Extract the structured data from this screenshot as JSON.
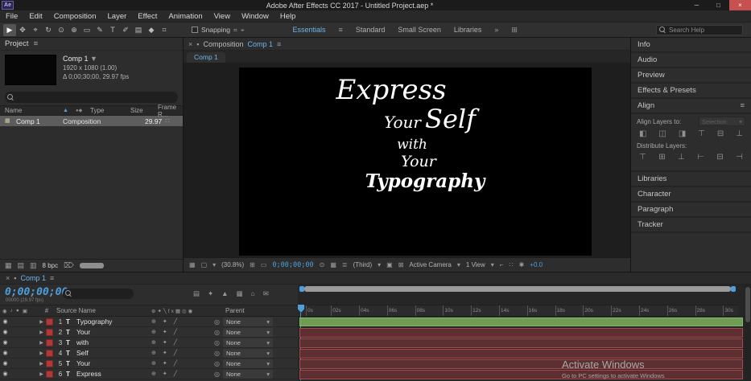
{
  "titlebar": {
    "app_icon": "Ae",
    "title": "Adobe After Effects CC 2017 - Untitled Project.aep *",
    "minimize": "─",
    "maximize": "□",
    "close": "×"
  },
  "menu": {
    "items": [
      "File",
      "Edit",
      "Composition",
      "Layer",
      "Effect",
      "Animation",
      "View",
      "Window",
      "Help"
    ]
  },
  "toolbar": {
    "tools": [
      "▶",
      "✥",
      "⌖",
      "↻",
      "⊙",
      "⊕",
      "▭",
      "✎",
      "T",
      "✐",
      "▤",
      "◆",
      "⌗"
    ],
    "snapping_label": "Snapping",
    "snap_icons": [
      "⌗",
      "⌖"
    ],
    "workspaces": [
      "Essentials",
      "Standard",
      "Small Screen",
      "Libraries"
    ],
    "workspace_menu_icon": "≡",
    "overflow_icon": "»",
    "panel_grid_icon": "⊞",
    "search_placeholder": "Search Help"
  },
  "project": {
    "tab_label": "Project",
    "menu_icon": "≡",
    "comp_name": "Comp 1",
    "comp_caret": "▼",
    "info_line1": "1920 x 1080 (1.00)",
    "info_line2": "Δ 0;00;30;00, 29.97 fps",
    "columns": {
      "name": "Name",
      "sort_icon": "▲",
      "tag_icons": "●◆",
      "type": "Type",
      "size": "Size",
      "frame": "Frame R..."
    },
    "row": {
      "icon": "▦",
      "name": "Comp 1",
      "type": "Composition",
      "size": "",
      "frame": "29.97",
      "net_icon": "∷"
    },
    "footer": {
      "icons": [
        "▦",
        "▤",
        "▥"
      ],
      "bpc": "8 bpc",
      "trash_icon": "⌦"
    }
  },
  "viewer": {
    "tab_close": "×",
    "lock_icon": "▪",
    "tab_label": "Composition",
    "tab_comp": "Comp 1",
    "menu_icon": "≡",
    "subtab": "Comp 1",
    "canvas": {
      "l1": "Express",
      "l2a": "Your",
      "l2b": "Self",
      "l3": "with",
      "l4": "Your",
      "l5": "Typography"
    },
    "footer": {
      "icon_grid": "▦",
      "icon_monitor": "▢",
      "zoom_caret": "▾",
      "zoom": "(30.8%)",
      "icon_ruler": "⊞",
      "icon_region": "▭",
      "timecode": "0;00;00;00",
      "icon_snapshot": "⊙",
      "icon_show": "▦",
      "icon_channels": "≣",
      "resolution": "(Third)",
      "caret": "▾",
      "icon_roi": "▣",
      "icon_transp": "⊠",
      "camera": "Active Camera",
      "view": "1 View",
      "icon_pixel": "⌐",
      "icon_views": "∷",
      "icon_settings": "✱",
      "exposure": "+0.0"
    }
  },
  "right": {
    "top_panels": [
      "Info",
      "Audio",
      "Preview",
      "Effects & Presets"
    ],
    "align": {
      "title": "Align",
      "menu_icon": "≡",
      "align_to_label": "Align Layers to:",
      "align_to_value": "Selection",
      "caret": "▾",
      "align_icons": [
        "◧",
        "◫",
        "◨",
        "⊤",
        "⊟",
        "⊥"
      ],
      "distribute_label": "Distribute Layers:",
      "distribute_icons": [
        "⊤",
        "⊞",
        "⊥",
        "⊢",
        "⊟",
        "⊣"
      ]
    },
    "bottom_panels": [
      "Libraries",
      "Character",
      "Paragraph",
      "Tracker"
    ]
  },
  "timeline": {
    "tab_close": "×",
    "pin_icon": "▪",
    "tab_label": "Comp 1",
    "menu_icon": "≡",
    "timecode": "0;00;00;00",
    "frame_info": "00000 (29.97 fps)",
    "mini_icons": [
      "▤",
      "✦",
      "▲",
      "▦",
      "⌂",
      "✉"
    ],
    "col_icons": {
      "eye": "◉",
      "audio": "♪",
      "solo": "●",
      "lock": "▣"
    },
    "columns": {
      "num": "#",
      "source": "Source Name",
      "switches": "⊕✦╲fx▦◎◉",
      "parent": "Parent"
    },
    "row_icons": {
      "expand": "▶",
      "type": "T",
      "sw1": "⊕",
      "sw2": "✦",
      "sw3": "╱",
      "target": "◎",
      "caret": "▾"
    },
    "layers": [
      {
        "num": "1",
        "name": "Typography",
        "parent": "None"
      },
      {
        "num": "2",
        "name": "Your",
        "parent": "None"
      },
      {
        "num": "3",
        "name": "with",
        "parent": "None"
      },
      {
        "num": "4",
        "name": "Self",
        "parent": "None"
      },
      {
        "num": "5",
        "name": "Your",
        "parent": "None"
      },
      {
        "num": "6",
        "name": "Express",
        "parent": "None"
      }
    ],
    "ruler": [
      "0s",
      "02s",
      "04s",
      "06s",
      "08s",
      "10s",
      "12s",
      "14s",
      "16s",
      "18s",
      "20s",
      "22s",
      "24s",
      "26s",
      "28s",
      "30s"
    ]
  },
  "watermark": {
    "line1": "Activate Windows",
    "line2": "Go to PC settings to activate Windows"
  }
}
